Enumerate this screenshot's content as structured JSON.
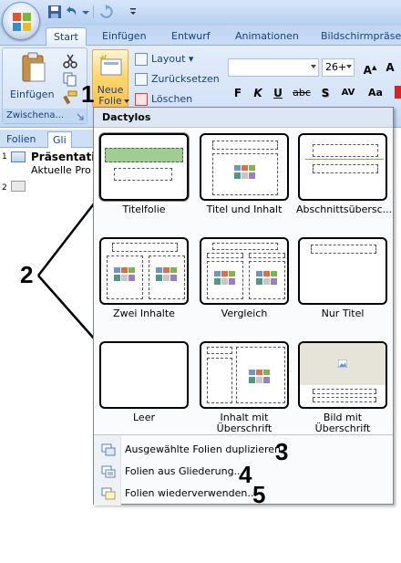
{
  "tabs": [
    {
      "label": "Start",
      "active": true
    },
    {
      "label": "Einfügen",
      "active": false
    },
    {
      "label": "Entwurf",
      "active": false
    },
    {
      "label": "Animationen",
      "active": false
    },
    {
      "label": "Bildschirmpräsen",
      "active": false
    }
  ],
  "ribbon": {
    "paste_label": "Einfügen",
    "clipboard_group_label": "Zwischena...",
    "new_slide_label": "Neue Folie",
    "layout_label": "Layout",
    "reset_label": "Zurücksetzen",
    "delete_label": "Löschen",
    "font_size": "26+",
    "format_buttons": [
      "F",
      "K",
      "U",
      "abc",
      "S",
      "AV",
      "Aa"
    ]
  },
  "slide_panel": {
    "tabs": [
      "Folien",
      "Gli"
    ],
    "items": [
      {
        "number": "1",
        "title": "Präsentati",
        "subtitle": "Aktuelle Pro"
      },
      {
        "number": "2",
        "title": "",
        "subtitle": ""
      }
    ]
  },
  "menu": {
    "header": "Dactylos",
    "layouts": [
      {
        "label": "Titelfolie"
      },
      {
        "label": "Titel und Inhalt"
      },
      {
        "label": "Abschnittsübersc..."
      },
      {
        "label": "Zwei Inhalte"
      },
      {
        "label": "Vergleich"
      },
      {
        "label": "Nur Titel"
      },
      {
        "label": "Leer"
      },
      {
        "label": "Inhalt mit\nÜberschrift"
      },
      {
        "label": "Bild mit\nÜberschrift"
      }
    ],
    "commands": [
      {
        "label": "Ausgewählte Folien duplizieren"
      },
      {
        "label": "Folien aus Gliederung..."
      },
      {
        "label": "Folien wiederverwenden..."
      }
    ]
  },
  "callouts": [
    "1",
    "2",
    "3",
    "4",
    "5"
  ],
  "colors": {
    "ribbon_blue": "#d4e3f8",
    "tab_text": "#15428b",
    "highlight_orange": "#ffc24a",
    "title_placeholder_green": "#9fcf8f"
  }
}
